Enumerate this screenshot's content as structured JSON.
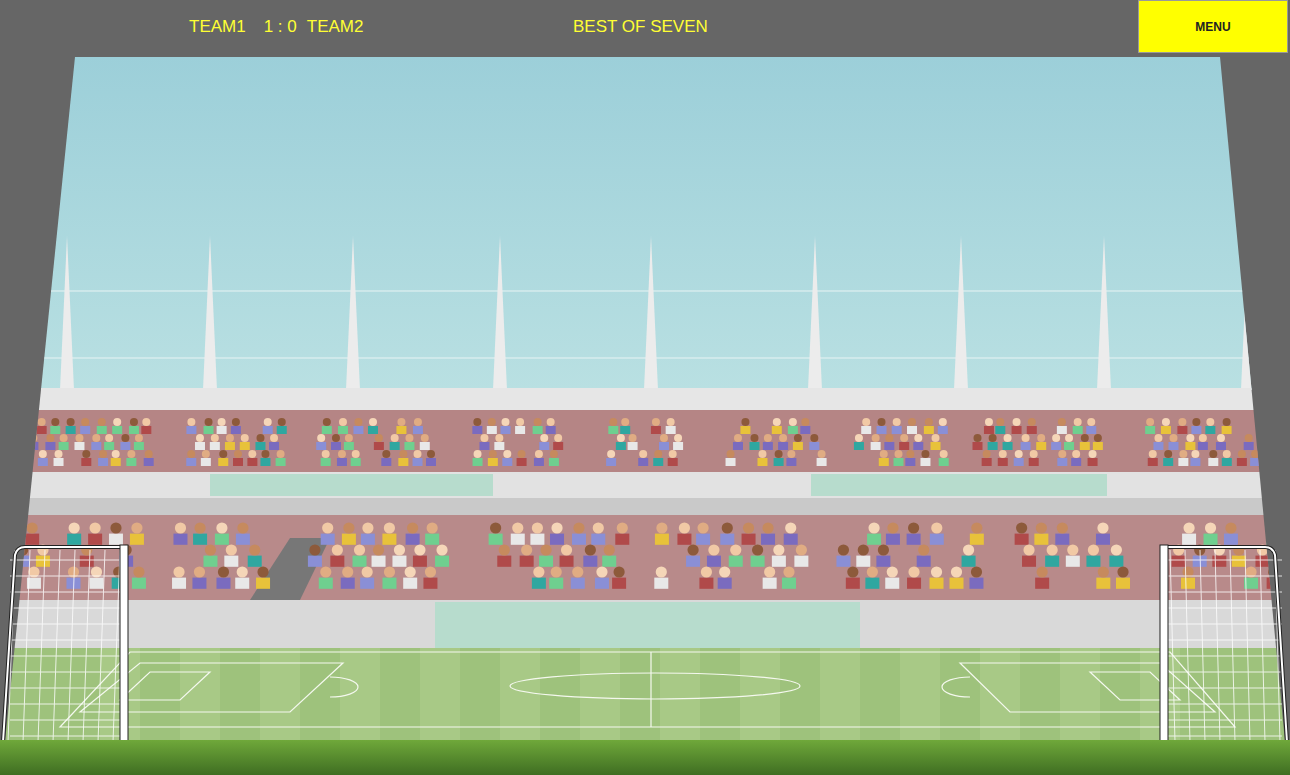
{
  "score_bar": {
    "team1": "TEAM1",
    "score": "1 : 0",
    "team2": "TEAM2",
    "mode": "BEST OF SEVEN"
  },
  "menu_button": {
    "label": "MENU"
  }
}
